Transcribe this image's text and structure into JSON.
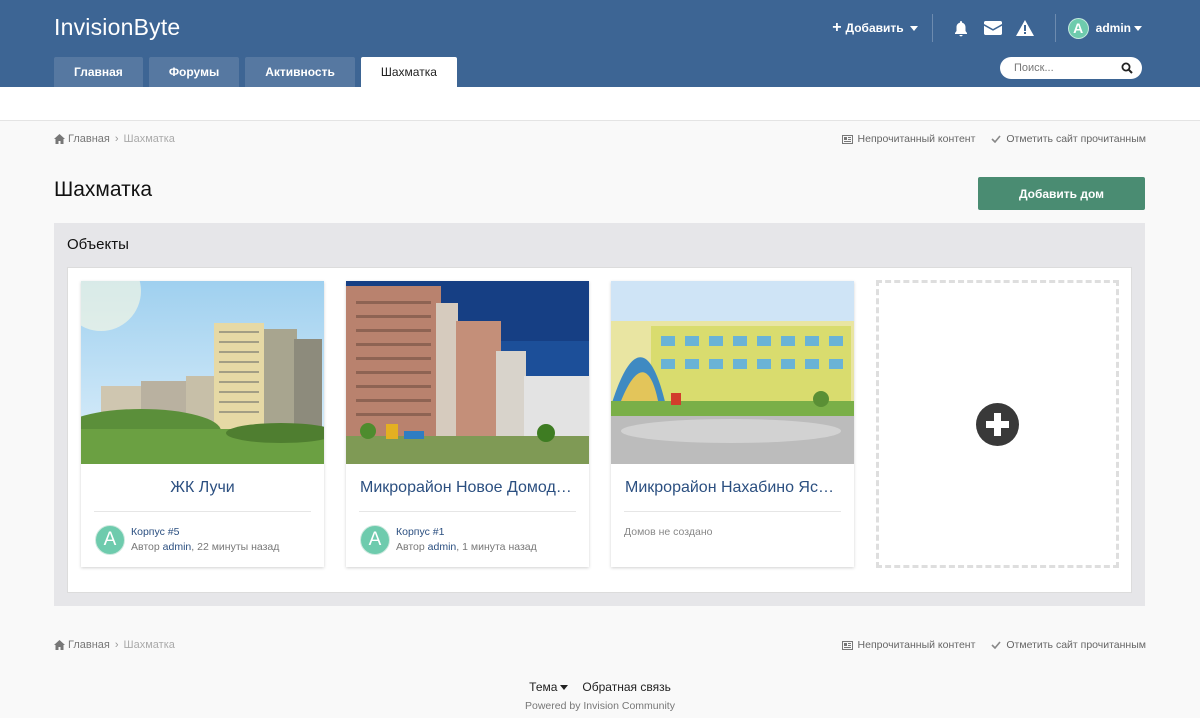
{
  "header": {
    "logo": "InvisionByte",
    "add_label": "Добавить",
    "user_initial": "A",
    "user_name": "admin",
    "bg_color": "#3d6594"
  },
  "nav": {
    "tabs": [
      {
        "label": "Главная"
      },
      {
        "label": "Форумы"
      },
      {
        "label": "Активность"
      },
      {
        "label": "Шахматка"
      }
    ],
    "active_tab": "Шахматка",
    "search_placeholder": "Поиск..."
  },
  "breadcrumb": {
    "home": "Главная",
    "current": "Шахматка",
    "unread": "Непрочитанный контент",
    "mark_read": "Отметить сайт прочитанным"
  },
  "page": {
    "title": "Шахматка",
    "add_house_label": "Добавить дом",
    "accent_color": "#4a8c72"
  },
  "section": {
    "title": "Объекты",
    "cards": [
      {
        "name": "ЖК Лучи",
        "item": "Корпус #5",
        "author_prefix": "Автор",
        "author": "admin",
        "time": ", 22 минуты назад",
        "initial": "A"
      },
      {
        "name": "Микрорайон Новое Домодедово",
        "item": "Корпус #1",
        "author_prefix": "Автор",
        "author": "admin",
        "time": ", 1 минута назад",
        "initial": "A"
      },
      {
        "name": "Микрорайон Нахабино Ясное",
        "empty_text": "Домов не создано"
      }
    ]
  },
  "footer": {
    "theme": "Тема",
    "feedback": "Обратная связь",
    "powered": "Powered by Invision Community"
  }
}
